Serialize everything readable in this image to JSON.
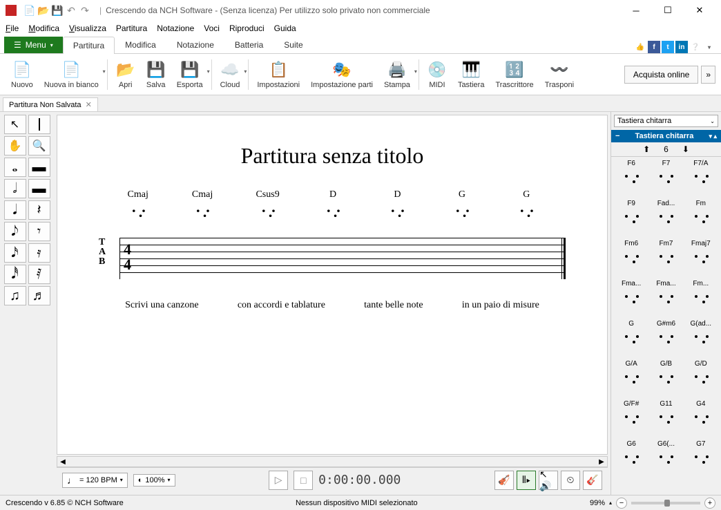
{
  "titlebar": {
    "title": "Crescendo da NCH Software - (Senza licenza) Per utilizzo solo privato non commerciale"
  },
  "menubar": [
    "File",
    "Modifica",
    "Visualizza",
    "Partitura",
    "Notazione",
    "Voci",
    "Riproduci",
    "Guida"
  ],
  "ribbon": {
    "menu": "Menu",
    "tabs": [
      "Partitura",
      "Modifica",
      "Notazione",
      "Batteria",
      "Suite"
    ],
    "items": [
      {
        "label": "Nuovo",
        "icon": "📄"
      },
      {
        "label": "Nuova in bianco",
        "icon": "📄",
        "dd": true
      },
      {
        "label": "Apri",
        "icon": "📂"
      },
      {
        "label": "Salva",
        "icon": "💾"
      },
      {
        "label": "Esporta",
        "icon": "💾",
        "dd": true
      },
      {
        "label": "Cloud",
        "icon": "☁️",
        "dd": true
      },
      {
        "label": "Impostazioni",
        "icon": "📋"
      },
      {
        "label": "Impostazione parti",
        "icon": "🎭"
      },
      {
        "label": "Stampa",
        "icon": "🖨️",
        "dd": true
      },
      {
        "label": "MIDI",
        "icon": "💿"
      },
      {
        "label": "Tastiera",
        "icon": "🎹"
      },
      {
        "label": "Trascrittore",
        "icon": "🔢"
      },
      {
        "label": "Trasponi",
        "icon": "〰️"
      }
    ],
    "purchase": "Acquista online"
  },
  "doctab": "Partitura Non Salvata",
  "score": {
    "title": "Partitura senza titolo",
    "chords": [
      "Cmaj",
      "Cmaj",
      "Csus9",
      "D",
      "D",
      "G",
      "G"
    ],
    "tab_label": [
      "T",
      "A",
      "B"
    ],
    "time_sig": [
      "4",
      "4"
    ],
    "lyrics": [
      "Scrivi una canzone",
      "con accordi e tablature",
      "tante belle note",
      "in un paio di misure"
    ]
  },
  "rightpanel": {
    "combo": "Tastiera chitarra",
    "header": "Tastiera chitarra",
    "page": "6",
    "chords": [
      [
        "F6",
        "F7",
        "F7/A"
      ],
      [
        "F9",
        "Fad...",
        "Fm"
      ],
      [
        "Fm6",
        "Fm7",
        "Fmaj7"
      ],
      [
        "Fma...",
        "Fma...",
        "Fm..."
      ],
      [
        "G",
        "G#m6",
        "G(ad..."
      ],
      [
        "G/A",
        "G/B",
        "G/D"
      ],
      [
        "G/F#",
        "G11",
        "G4"
      ],
      [
        "G6",
        "G6(...",
        "G7"
      ]
    ]
  },
  "transport": {
    "bpm_value": "= 120 BPM",
    "zoom": "100%",
    "timecode": "0:00:00.000"
  },
  "statusbar": {
    "version": "Crescendo v 6.85 © NCH Software",
    "midi": "Nessun dispositivo MIDI selezionato",
    "zoom": "99%"
  }
}
